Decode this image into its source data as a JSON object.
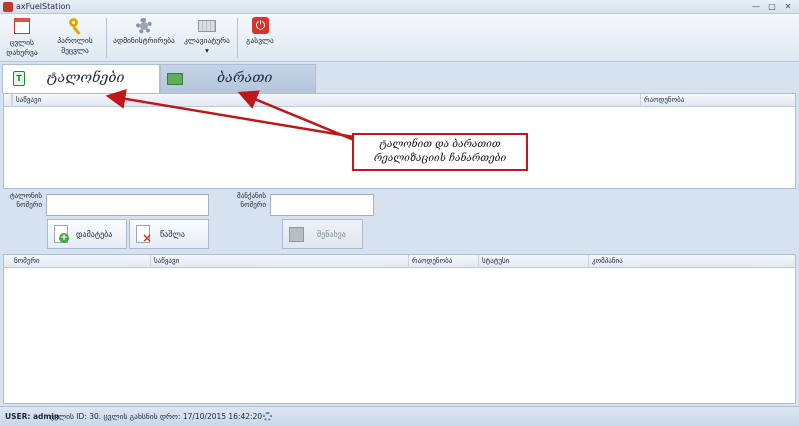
{
  "window": {
    "title": "axFuelStation",
    "minimize": "—",
    "maximize": "□",
    "close": "✕"
  },
  "toolbar": {
    "items": [
      {
        "label": "ცვლის\nდახურვა",
        "icon": "calendar-icon"
      },
      {
        "label": "პაროლის\nშეცვლა",
        "icon": "key-icon"
      },
      {
        "label": "ადმინისტრირება",
        "icon": "gear-icon"
      },
      {
        "label": "კლავიატურა\n▾",
        "icon": "keyboard-icon"
      },
      {
        "label": "გასვლა",
        "icon": "power-icon"
      }
    ]
  },
  "tabs": [
    {
      "label": "ტალონები",
      "icon": "talon-icon",
      "active": true
    },
    {
      "label": "ბარათი",
      "icon": "card-icon",
      "active": false
    }
  ],
  "top_grid": {
    "columns": [
      "საწვავი",
      "რაოდენობა"
    ]
  },
  "form": {
    "talon_label": "ტალონის\nნომერი",
    "car_label": "მანქანის\nნომერი",
    "talon_value": "",
    "car_value": "",
    "add_label": "დამატება",
    "delete_label": "წაშლა",
    "save_label": "შენახვა"
  },
  "bottom_grid": {
    "columns": [
      "ნომერი",
      "საწვავი",
      "რაოდენობა",
      "სტატუსი",
      "კომპანია"
    ]
  },
  "status": {
    "user": "USER: admin",
    "info": "ცვლის ID: 30. ცვლის გახსნის დრო: 17/10/2015 16:42:20"
  },
  "annotation": {
    "text": "ტალონით და ბარათით\nრეალიზაციის ჩანართები",
    "color": "#c0181a"
  }
}
